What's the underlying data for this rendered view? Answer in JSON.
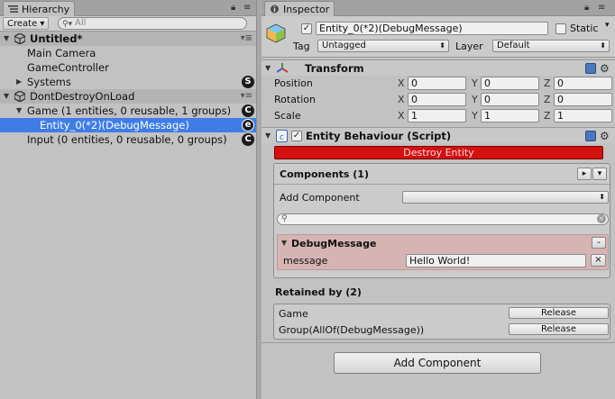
{
  "hierarchy": {
    "tab_label": "Hierarchy",
    "create_label": "Create",
    "search_placeholder": "All",
    "rows": [
      {
        "label": "Untitled*"
      },
      {
        "label": "Main Camera"
      },
      {
        "label": "GameController"
      },
      {
        "label": "Systems",
        "badge": "S"
      },
      {
        "label": "DontDestroyOnLoad"
      },
      {
        "label": "Game (1 entities, 0 reusable, 1 groups)",
        "badge": "C"
      },
      {
        "label": "Entity_0(*2)(DebugMessage)",
        "badge": "e"
      },
      {
        "label": "Input (0 entities, 0 reusable, 0 groups)",
        "badge": "C"
      }
    ]
  },
  "inspector": {
    "tab_label": "Inspector",
    "object_name": "Entity_0(*2)(DebugMessage)",
    "static_label": "Static",
    "tag_label": "Tag",
    "tag_value": "Untagged",
    "layer_label": "Layer",
    "layer_value": "Default",
    "transform": {
      "title": "Transform",
      "rows": [
        {
          "label": "Position",
          "x": "0",
          "y": "0",
          "z": "0"
        },
        {
          "label": "Rotation",
          "x": "0",
          "y": "0",
          "z": "0"
        },
        {
          "label": "Scale",
          "x": "1",
          "y": "1",
          "z": "1"
        }
      ],
      "axis_x": "X",
      "axis_y": "Y",
      "axis_z": "Z"
    },
    "entity_behaviour": {
      "title": "Entity Behaviour (Script)",
      "destroy_label": "Destroy Entity",
      "components_title": "Components (1)",
      "add_component_label": "Add Component",
      "component_name": "DebugMessage",
      "field_label": "message",
      "field_value": "Hello World!",
      "retained_title": "Retained by (2)",
      "retained": [
        {
          "name": "Game",
          "button": "Release"
        },
        {
          "name": "Group(AllOf(DebugMessage))",
          "button": "Release"
        }
      ]
    },
    "add_component_button": "Add Component"
  },
  "colors": {
    "selection": "#3e7de7",
    "destroy": "#d41010",
    "component_bg": "#d6b4b4"
  }
}
